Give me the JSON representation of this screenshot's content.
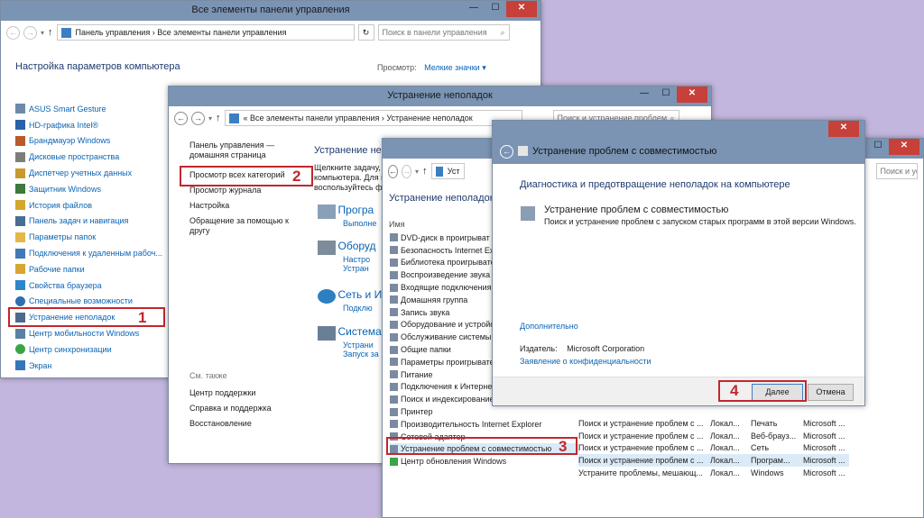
{
  "win1": {
    "title": "Все элементы панели управления",
    "address": "Панель управления › Все элементы панели управления",
    "search_placeholder": "Поиск в панели управления",
    "heading": "Настройка параметров компьютера",
    "view_label": "Просмотр:",
    "view_value": "Мелкие значки ▾",
    "items": [
      "ASUS Smart Gesture",
      "HD-графика Intel®",
      "Брандмауэр Windows",
      "Дисковые пространства",
      "Диспетчер учетных данных",
      "Защитник Windows",
      "История файлов",
      "Панель задач и навигация",
      "Параметры папок",
      "Подключения к удаленным рабоч...",
      "Рабочие папки",
      "Свойства браузера",
      "Специальные возможности",
      "Устранение неполадок",
      "Центр мобильности Windows",
      "Центр синхронизации",
      "Экран"
    ],
    "marker_number": "1"
  },
  "win2": {
    "title": "Устранение неполадок",
    "address": "« Все элементы панели управления › Устранение неполадок",
    "search_placeholder": "Поиск и устранение проблем",
    "sidebar": [
      "Панель управления — домашняя страница",
      "Просмотр всех категорий",
      "Просмотр журнала",
      "Настройка",
      "Обращение за помощью к другу"
    ],
    "see_also_label": "См. также",
    "see_also": [
      "Центр поддержки",
      "Справка и поддержка",
      "Восстановление"
    ],
    "heading": "Устранение не",
    "desc_lines": [
      "Щелкните задачу, ч",
      "компьютера. Для и",
      "воспользуйтесь ф"
    ],
    "categories": [
      {
        "title": "Програ",
        "subs": [
          "Выполне"
        ]
      },
      {
        "title": "Оборуд",
        "subs": [
          "Настро",
          "Устран"
        ]
      },
      {
        "title": "Сеть и И",
        "subs": [
          "Подклю"
        ]
      },
      {
        "title": "Система",
        "subs": [
          "Устрани",
          "Запуск за"
        ]
      }
    ],
    "marker_number": "2"
  },
  "win3": {
    "address_fragment": "Уст",
    "search_placeholder": "Поиск и устранение проблем",
    "heading": "Устранение неполадок",
    "col_name": "Имя",
    "rows": [
      "DVD-диск в проигрыват",
      "Безопасность Internet Explor",
      "Библиотека проигрывате",
      "Воспроизведение звука",
      "Входящие подключения",
      "Домашняя группа",
      "Запись звука",
      "Оборудование и устройс",
      "Обслуживание системы",
      "Общие папки",
      "Параметры проигрывате",
      "Питание",
      "Подключения к Интернет",
      "Поиск и индексирование",
      "Принтер",
      "Производительность Internet Explorer",
      "Сетевой адаптер",
      "Устранение проблем с совместимостью",
      "Центр обновления Windows"
    ],
    "extra_rows": [
      {
        "desc": "Поиск и устранение проблем с ...",
        "loc": "Локал...",
        "cat": "Печать",
        "pub": "Microsoft ..."
      },
      {
        "desc": "Поиск и устранение проблем с ...",
        "loc": "Локал...",
        "cat": "Веб-брауз...",
        "pub": "Microsoft ..."
      },
      {
        "desc": "Поиск и устранение проблем с ...",
        "loc": "Локал...",
        "cat": "Сеть",
        "pub": "Microsoft ..."
      },
      {
        "desc": "Поиск и устранение проблем с ...",
        "loc": "Локал...",
        "cat": "Програм...",
        "pub": "Microsoft ..."
      },
      {
        "desc": "Устраните проблемы, мешающ...",
        "loc": "Локал...",
        "cat": "Windows",
        "pub": "Microsoft ..."
      }
    ],
    "marker_number": "3"
  },
  "dialog": {
    "title": "Устранение проблем с совместимостью",
    "heading": "Диагностика и предотвращение неполадок на компьютере",
    "item_title": "Устранение проблем с совместимостью",
    "item_desc": "Поиск и устранение проблем с запуском старых программ в этой версии Windows.",
    "advanced": "Дополнительно",
    "publisher_label": "Издатель:",
    "publisher_value": "Microsoft Corporation",
    "privacy": "Заявление о конфиденциальности",
    "next": "Далее",
    "cancel": "Отмена",
    "marker_number": "4"
  }
}
